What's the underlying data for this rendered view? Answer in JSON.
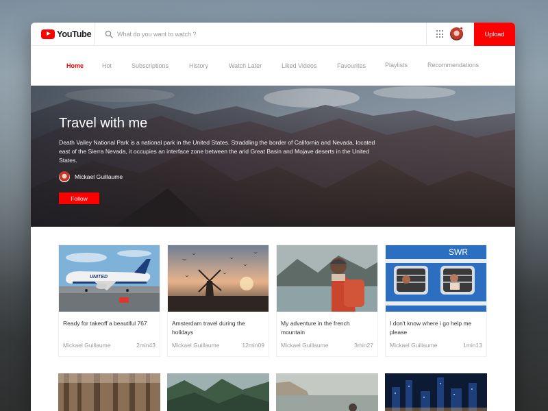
{
  "app": {
    "logo_text": "YouTube"
  },
  "search": {
    "placeholder": "What do you want to watch ?"
  },
  "header": {
    "upload_label": "Upload"
  },
  "nav": {
    "items": [
      {
        "label": "Home",
        "active": true
      },
      {
        "label": "Hot"
      },
      {
        "label": "Subscriptions"
      },
      {
        "label": "History"
      },
      {
        "label": "Watch Later"
      },
      {
        "label": "Liked Videos"
      },
      {
        "label": "Favourites"
      },
      {
        "label": "Playlists"
      },
      {
        "label": "Recommendations"
      }
    ]
  },
  "hero": {
    "title": "Travel with me",
    "description": "Death Valley National Park is a national park in the United States. Straddling the border of California and Nevada, located east of the Sierra Nevada, it occupies an interface zone between the arid Great Basin and Mojave deserts in the United States.",
    "author": "Mickael Guillaume",
    "follow_label": "Follow"
  },
  "videos": [
    {
      "title": "Ready for takeoff a beautiful 767",
      "author": "Mickael Guillaume",
      "duration": "2min43",
      "thumb": "airplane-thumbnail"
    },
    {
      "title": "Amsterdam travel during the holidays",
      "author": "Mickael Guillaume",
      "duration": "12min09",
      "thumb": "windmill-thumbnail"
    },
    {
      "title": "My adventure in the french mountain",
      "author": "Mickael Guillaume",
      "duration": "3min27",
      "thumb": "hiker-thumbnail"
    },
    {
      "title": "I don't know where i go help me please",
      "author": "Mickael Guillaume",
      "duration": "1min13",
      "thumb": "train-thumbnail",
      "sign_text": "SWR"
    }
  ],
  "colors": {
    "accent": "#ff0000",
    "text": "#333333",
    "muted": "#999999"
  }
}
